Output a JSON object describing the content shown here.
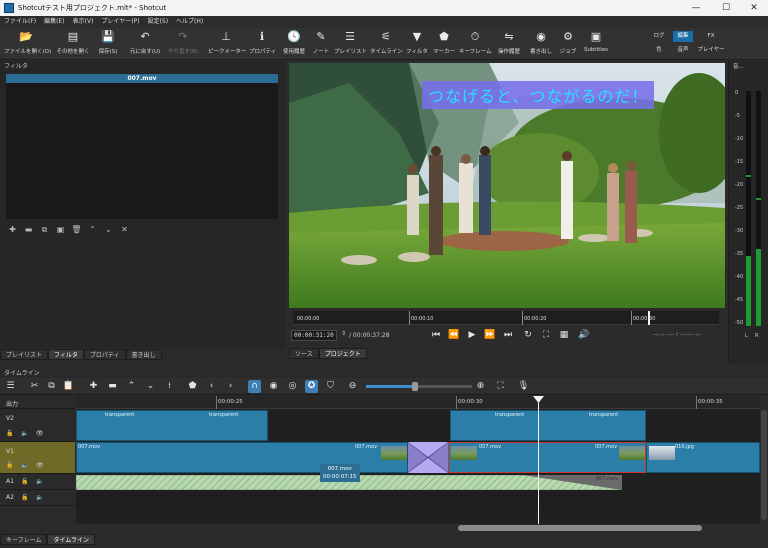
{
  "window": {
    "title": "Shotcutテスト用プロジェクト.mlt* - Shotcut",
    "controls": [
      "—",
      "☐",
      "✕"
    ]
  },
  "menu": [
    "ファイル(F)",
    "編集(E)",
    "表示(V)",
    "プレイヤー(P)",
    "設定(S)",
    "ヘルプ(H)"
  ],
  "toolbar": {
    "items": [
      {
        "label": "ファイルを開く(O)",
        "icon": "folder-icon",
        "glyph": "📂"
      },
      {
        "label": "その他を開く",
        "icon": "open-other-icon",
        "glyph": "▤"
      },
      {
        "label": "保存(S)",
        "icon": "save-icon",
        "glyph": "💾"
      },
      {
        "label": "元に戻す(U)",
        "icon": "undo-icon",
        "glyph": "↶"
      },
      {
        "label": "やり直す(R)",
        "icon": "redo-icon",
        "glyph": "↷"
      },
      {
        "label": "ピークメーター",
        "icon": "peak-meter-icon",
        "glyph": "⊥"
      },
      {
        "label": "プロパティ",
        "icon": "properties-icon",
        "glyph": "ℹ"
      },
      {
        "label": "使用履歴",
        "icon": "history-icon",
        "glyph": "🕓"
      },
      {
        "label": "ノート",
        "icon": "notes-icon",
        "glyph": "✎"
      },
      {
        "label": "プレイリスト",
        "icon": "playlist-icon",
        "glyph": "☰"
      },
      {
        "label": "タイムライン",
        "icon": "timeline-icon",
        "glyph": "⚟"
      },
      {
        "label": "フィルタ",
        "icon": "filter-icon",
        "glyph": "▼"
      },
      {
        "label": "マーカー",
        "icon": "marker-icon",
        "glyph": "⬟"
      },
      {
        "label": "キーフレーム",
        "icon": "keyframe-icon",
        "glyph": "⏱"
      },
      {
        "label": "操作履歴",
        "icon": "undo-history-icon",
        "glyph": "⇋"
      },
      {
        "label": "書き出し",
        "icon": "export-icon",
        "glyph": "◉"
      },
      {
        "label": "ジョブ",
        "icon": "jobs-icon",
        "glyph": "⚙"
      },
      {
        "label": "Subtitles",
        "icon": "subtitles-icon",
        "glyph": "▣"
      }
    ],
    "layouts": {
      "log": "ログ",
      "edit": "編集",
      "fx": "FX",
      "color": "色",
      "audio": "音声",
      "player": "プレイヤー"
    }
  },
  "filters": {
    "panel_title": "フィルタ",
    "current_clip": "007.mov",
    "buttons": [
      "✚",
      "▬",
      "⧉",
      "▣",
      "🗑",
      "⌃",
      "⌄",
      "✕"
    ]
  },
  "left_tabs": [
    "プレイリスト",
    "フィルタ",
    "プロパティ",
    "書き出し"
  ],
  "player": {
    "subtitle": "つなげると、つながるのだ！",
    "ruler_labels": [
      "00:00:00",
      "00:00:10",
      "00:00:20",
      "00:00:30"
    ],
    "timecode": "00:00:31:20",
    "duration": "/ 00:00:37:28",
    "in_out": "--:--:--:-- / --:--:--:--",
    "tabs": [
      "ソース",
      "プロジェクト"
    ]
  },
  "meter": {
    "labels": [
      "0",
      "-5",
      "-10",
      "-15",
      "-20",
      "-25",
      "-30",
      "-35",
      "-40",
      "-45",
      "-50"
    ],
    "channels": [
      "L",
      "R"
    ],
    "level_db": [
      -30,
      -28
    ]
  },
  "timeline": {
    "title": "タイムライン",
    "output_label": "出力",
    "ruler_labels": [
      "00:00:25",
      "00:00:30",
      "00:00:35"
    ],
    "tracks": [
      "V2",
      "V1",
      "A1",
      "A2"
    ],
    "v2_clips": [
      {
        "name": "transparent"
      },
      {
        "name": "transparent"
      },
      {
        "name": "transparent"
      },
      {
        "name": "transparent"
      }
    ],
    "v1_clips": [
      "007.mov",
      "007.mov",
      "007.mov",
      "007.mov",
      "010.jpg"
    ],
    "a1_label": "007.mov",
    "a1_tooltip_name": "007.mov",
    "a1_tooltip_time": "00:00:07:15"
  },
  "bottom_tabs": [
    "キーフレーム",
    "タイムライン"
  ]
}
